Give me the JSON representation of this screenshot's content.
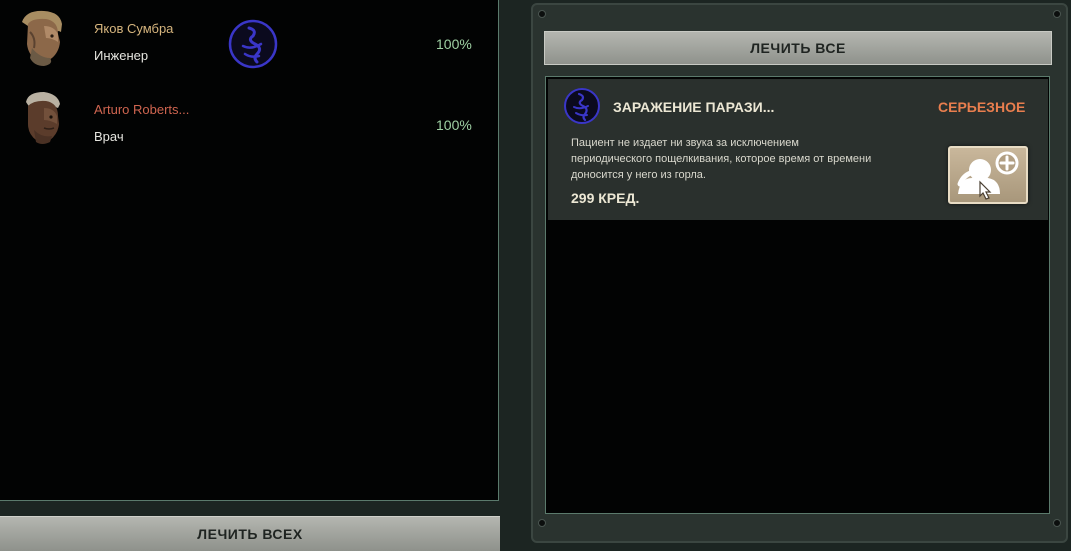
{
  "crew": [
    {
      "name": "Яков Сумбра",
      "role": "Инженер",
      "percent": "100%",
      "name_color": "#d6b57e",
      "has_affliction_icon": true
    },
    {
      "name": "Arturo Roberts...",
      "role": "Врач",
      "percent": "100%",
      "name_color": "#cf6550",
      "has_affliction_icon": false
    }
  ],
  "left_button": {
    "label": "ЛЕЧИТЬ ВСЕХ"
  },
  "right_button": {
    "label": "ЛЕЧИТЬ ВСЕ"
  },
  "affliction": {
    "icon": "parasite-icon",
    "title": "ЗАРАЖЕНИЕ ПАРАЗИ...",
    "severity": "СЕРЬЕЗНОЕ",
    "description_lines": [
      "Пациент не издает ни звука за исключением",
      "периодического пощелкивания, которое время от времени",
      "доносится у него из горла."
    ],
    "price": "299 КРЕД.",
    "treat_icon": "heal-patient-icon"
  },
  "colors": {
    "accent_purple": "#3a36c8",
    "severity_orange": "#e97e4e",
    "health_green": "#9fd1a4",
    "frame_border": "#5b7a6c"
  }
}
